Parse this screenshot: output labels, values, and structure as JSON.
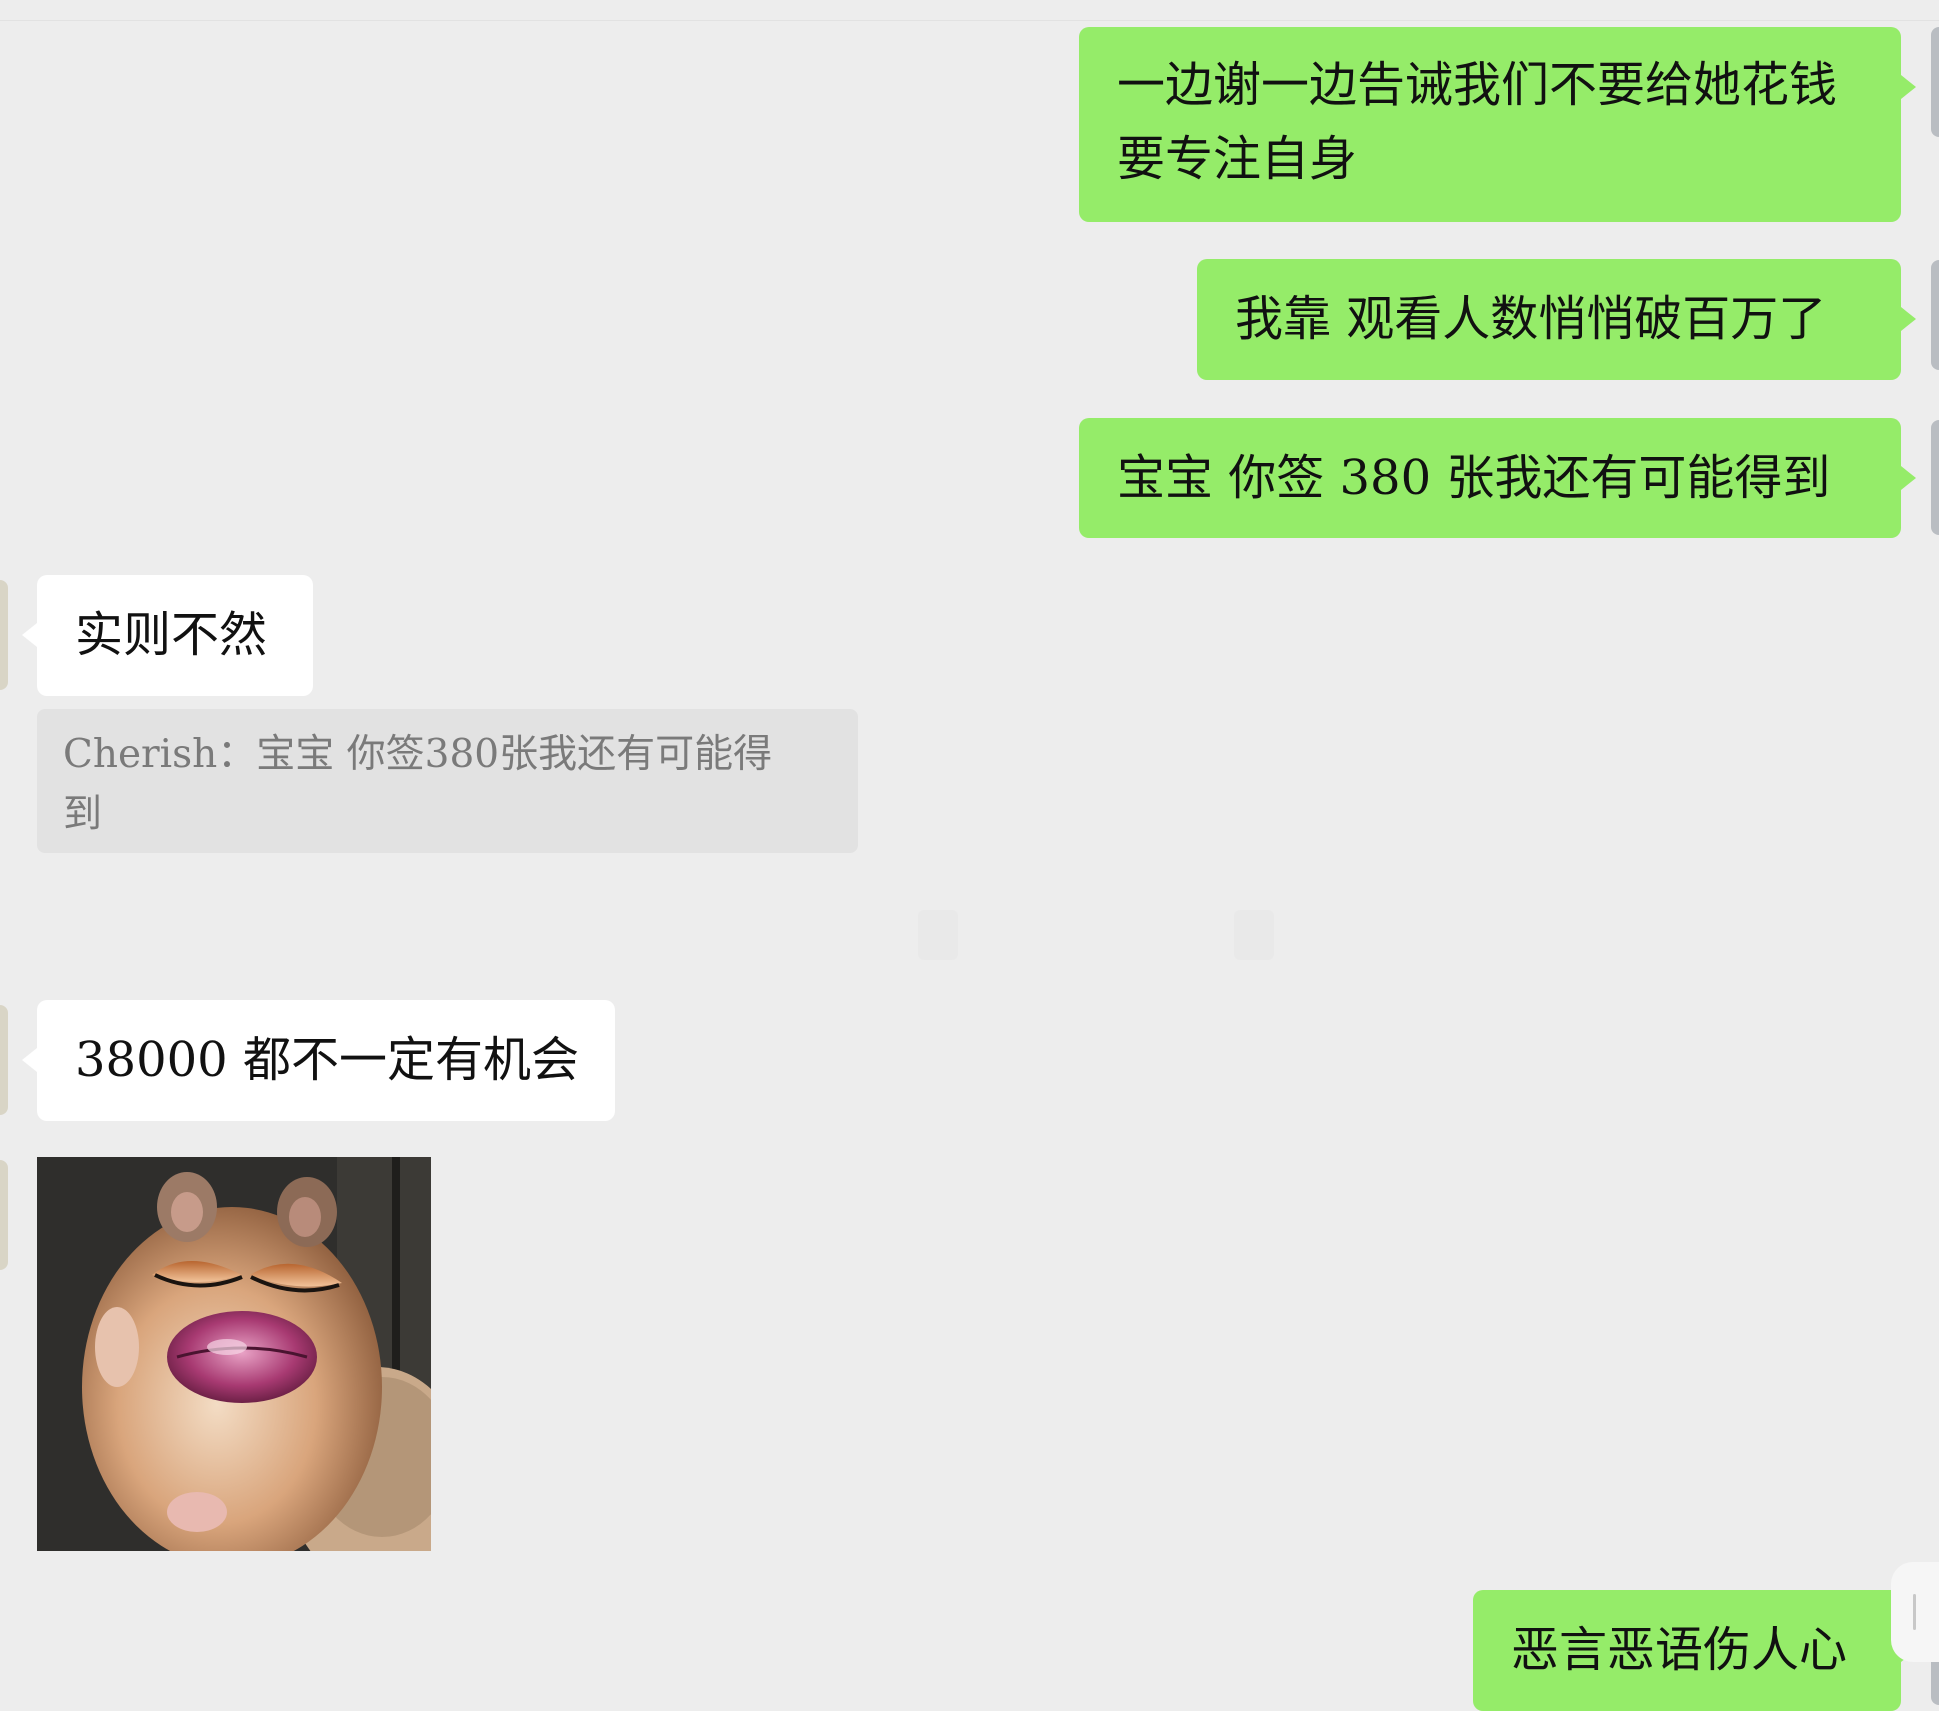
{
  "conversation": {
    "outgoing": [
      {
        "line1": "一边谢一边告诫我们不要给她花钱",
        "line2": "要专注自身"
      },
      {
        "text": "我靠  观看人数悄悄破百万了"
      },
      {
        "text": "宝宝  你签 380 张我还有可能得到"
      },
      {
        "text": "恶言恶语伤人心"
      }
    ],
    "incoming": [
      {
        "text": "实则不然"
      },
      {
        "text": "38000 都不一定有机会"
      }
    ],
    "quoted_reply": {
      "line1": "Cherish：宝宝  你签380张我还有可能得",
      "line2": "到"
    },
    "sticker": {
      "description": "hamster-sticker"
    }
  },
  "colors": {
    "background": "#ededed",
    "outgoing_bubble": "#95ec69",
    "incoming_bubble": "#ffffff",
    "quote_block": "#e2e2e2"
  }
}
